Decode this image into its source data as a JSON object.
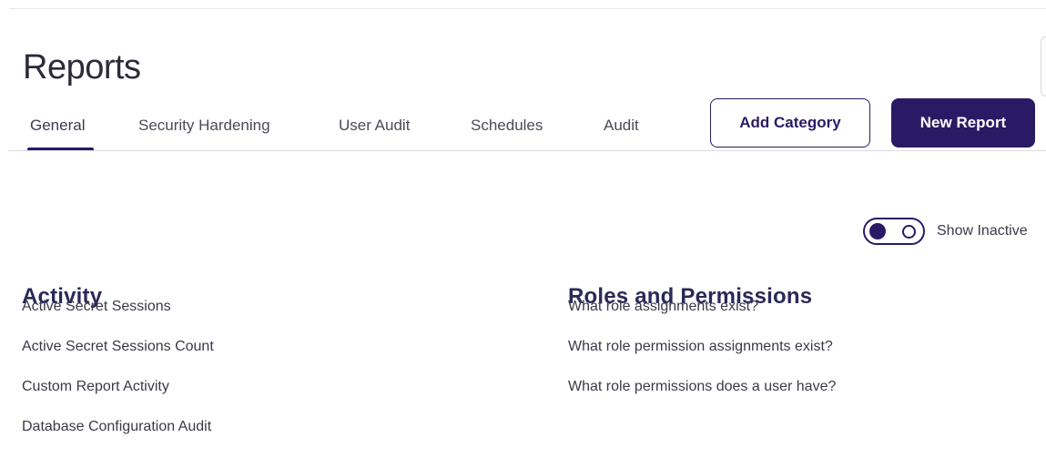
{
  "page": {
    "title": "Reports"
  },
  "tabs": [
    {
      "label": "General",
      "active": true
    },
    {
      "label": "Security Hardening",
      "active": false
    },
    {
      "label": "User Audit",
      "active": false
    },
    {
      "label": "Schedules",
      "active": false
    },
    {
      "label": "Audit",
      "active": false
    }
  ],
  "actions": {
    "add_category_label": "Add Category",
    "new_report_label": "New Report"
  },
  "toggle": {
    "label": "Show Inactive",
    "checked": true
  },
  "sections": {
    "activity": {
      "heading": "Activity",
      "items": [
        "Active Secret Sessions",
        "Active Secret Sessions Count",
        "Custom Report Activity",
        "Database Configuration Audit"
      ]
    },
    "roles": {
      "heading": "Roles and Permissions",
      "items": [
        "What role assignments exist?",
        "What role permission assignments exist?",
        "What role permissions does a user have?"
      ]
    }
  },
  "colors": {
    "accent": "#2a1a66",
    "text": "#3a3a48",
    "divider": "#dcdce3"
  }
}
